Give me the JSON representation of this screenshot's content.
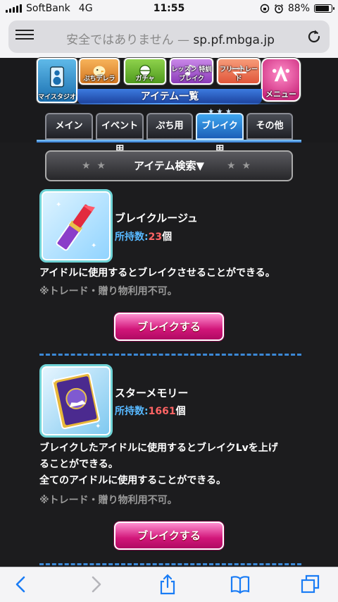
{
  "status": {
    "carrier": "SoftBank",
    "network": "4G",
    "time": "11:55",
    "battery": "88%",
    "battery_level": 0.88
  },
  "browser": {
    "url_prefix": "安全ではありません — ",
    "url_domain": "sp.pf.mbga.jp"
  },
  "game_nav": {
    "items": [
      {
        "label": "マイスタジオ",
        "icon": "speaker-icon"
      },
      {
        "label": "ぷちデレラ",
        "icon": "chick-icon"
      },
      {
        "label": "ガチャ",
        "icon": "gacha-icon"
      },
      {
        "label": "レッスン 特訓 ブレイク",
        "icon": "music-note-icon"
      },
      {
        "label": "フリートレード",
        "icon": "trade-icon"
      },
      {
        "label": "メニュー",
        "icon": "menu-emblem-icon"
      }
    ],
    "section_title": "アイテム一覧"
  },
  "tabs": [
    {
      "label": "メイン",
      "active": false
    },
    {
      "label": "イベント用",
      "active": false
    },
    {
      "label": "ぷち用",
      "active": false
    },
    {
      "label": "ブレイク用",
      "active": true
    },
    {
      "label": "その他",
      "active": false
    }
  ],
  "search": {
    "label": "アイテム検索▼"
  },
  "items": [
    {
      "name": "ブレイクルージュ",
      "owned_label": "所持数:",
      "owned_count": "23",
      "owned_unit": "個",
      "desc_lines": [
        "アイドルに使用するとブレイクさせることができる。"
      ],
      "note": "※トレード・贈り物利用不可。",
      "button": "ブレイクする",
      "icon": "lipstick-icon"
    },
    {
      "name": "スターメモリー",
      "owned_label": "所持数:",
      "owned_count": "1661",
      "owned_unit": "個",
      "desc_lines": [
        "ブレイクしたアイドルに使用するとブレイクLvを上げ",
        "ることができる。",
        "全てのアイドルに使用することができる。"
      ],
      "note": "※トレード・贈り物利用不可。",
      "button": "ブレイクする",
      "icon": "star-memory-book-icon"
    }
  ],
  "toolbar": {
    "icons": [
      "back-icon",
      "forward-icon",
      "share-icon",
      "bookmarks-icon",
      "tabs-icon"
    ]
  },
  "colors": {
    "accent_blue": "#3fa6ef",
    "button_pink": "#d11679",
    "owned_count": "#ff6464",
    "owned_label": "#57b8ff"
  }
}
